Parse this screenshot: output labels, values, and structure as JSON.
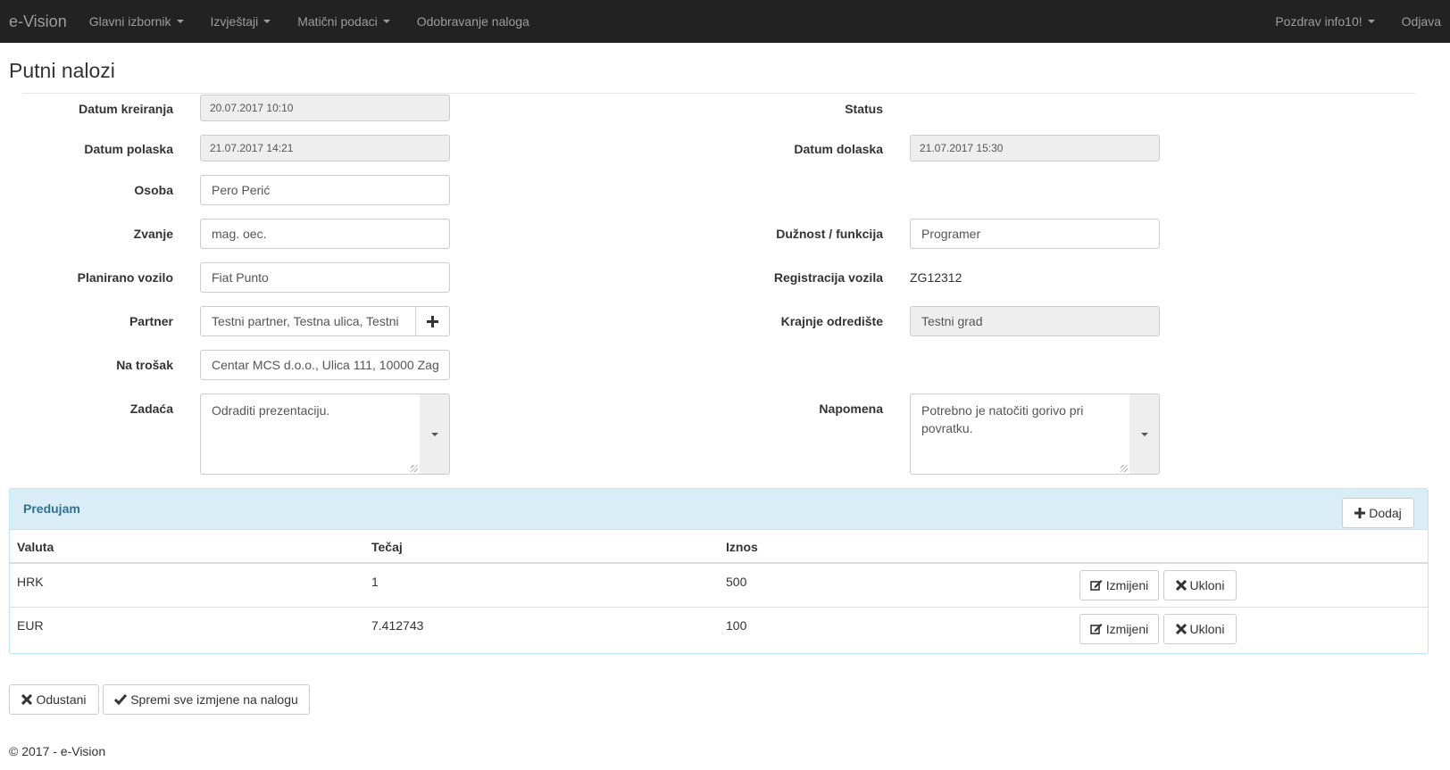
{
  "navbar": {
    "brand": "e-Vision",
    "menu": [
      {
        "label": "Glavni izbornik"
      },
      {
        "label": "Izvještaji"
      },
      {
        "label": "Matični podaci"
      },
      {
        "label": "Odobravanje naloga"
      }
    ],
    "greeting": "Pozdrav info10!",
    "logout": "Odjava"
  },
  "page": {
    "title": "Putni nalozi"
  },
  "form": {
    "datum_kreiranja": {
      "label": "Datum kreiranja",
      "value": "20.07.2017  10:10"
    },
    "status": {
      "label": "Status",
      "value": ""
    },
    "datum_polaska": {
      "label": "Datum polaska",
      "value": "21.07.2017  14:21"
    },
    "datum_dolaska": {
      "label": "Datum dolaska",
      "value": "21.07.2017  15:30"
    },
    "osoba": {
      "label": "Osoba",
      "value": "Pero Perić"
    },
    "zvanje": {
      "label": "Zvanje",
      "value": "mag. oec."
    },
    "duznost": {
      "label": "Dužnost / funkcija",
      "value": "Programer"
    },
    "planirano_vozilo": {
      "label": "Planirano vozilo",
      "value": "Fiat Punto"
    },
    "registracija_vozila": {
      "label": "Registracija vozila",
      "value": "ZG12312"
    },
    "partner": {
      "label": "Partner",
      "value": "Testni partner, Testna ulica, Testni"
    },
    "krajnje_odrediste": {
      "label": "Krajnje odredište",
      "value": "Testni grad"
    },
    "na_trosak": {
      "label": "Na trošak",
      "value": "Centar MCS d.o.o., Ulica 111, 10000 Zag"
    },
    "zadaca": {
      "label": "Zadaća",
      "value": "Odraditi prezentaciju."
    },
    "napomena": {
      "label": "Napomena",
      "value": "Potrebno je natočiti gorivo pri povratku."
    }
  },
  "predujam": {
    "title": "Predujam",
    "add_label": "Dodaj",
    "columns": [
      "Valuta",
      "Tečaj",
      "Iznos"
    ],
    "rows": [
      {
        "valuta": "HRK",
        "tecaj": "1",
        "iznos": "500"
      },
      {
        "valuta": "EUR",
        "tecaj": "7.412743",
        "iznos": "100"
      }
    ],
    "edit_label": "Izmijeni",
    "remove_label": "Ukloni"
  },
  "actions": {
    "cancel_label": "Odustani",
    "save_label": "Spremi sve izmjene na nalogu"
  },
  "footer": {
    "text": "© 2017 - e-Vision"
  }
}
